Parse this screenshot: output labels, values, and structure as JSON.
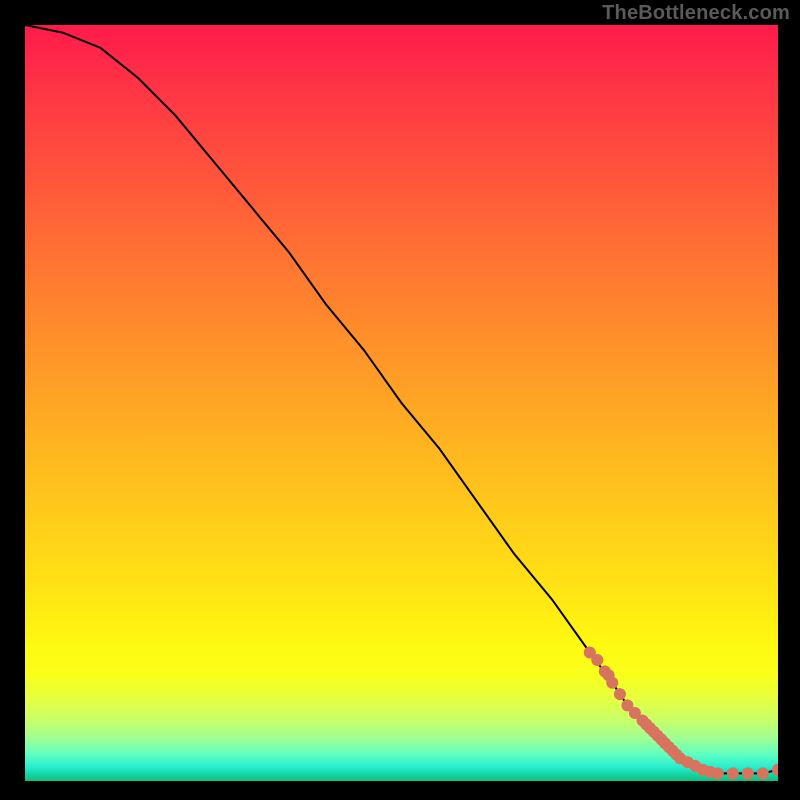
{
  "attribution": "TheBottleneck.com",
  "chart_data": {
    "type": "line",
    "title": "",
    "xlabel": "",
    "ylabel": "",
    "xlim": [
      0,
      100
    ],
    "ylim": [
      0,
      100
    ],
    "series": [
      {
        "name": "curve",
        "x": [
          0,
          5,
          10,
          15,
          20,
          25,
          30,
          35,
          40,
          45,
          50,
          55,
          60,
          65,
          70,
          75,
          78,
          80,
          82,
          84,
          86,
          88,
          90,
          92,
          94,
          96,
          98,
          100
        ],
        "y": [
          100,
          99,
          97,
          93,
          88,
          82,
          76,
          70,
          63,
          57,
          50,
          44,
          37,
          30,
          24,
          17,
          13,
          10,
          8,
          6,
          4,
          2.5,
          1.5,
          1,
          1,
          1,
          1,
          1.5
        ]
      }
    ],
    "scatter_points": {
      "name": "dots",
      "x": [
        75,
        76,
        77,
        77.5,
        78,
        79,
        80,
        81,
        82,
        82.5,
        83,
        83.5,
        84,
        84.5,
        85,
        85.5,
        86,
        86.5,
        87,
        88,
        89,
        90,
        91,
        92,
        94,
        96,
        98,
        100
      ],
      "y": [
        17,
        16,
        14.5,
        14,
        13,
        11.5,
        10,
        9,
        8,
        7.5,
        7,
        6.5,
        6,
        5.5,
        5,
        4.5,
        4,
        3.5,
        3,
        2.5,
        2,
        1.5,
        1.2,
        1,
        1,
        1,
        1,
        1.5
      ]
    },
    "gradient_stops": [
      {
        "pos": 0,
        "color": "#ff1a4b"
      },
      {
        "pos": 50,
        "color": "#ff9b27"
      },
      {
        "pos": 82,
        "color": "#fff911"
      },
      {
        "pos": 100,
        "color": "#0fbf80"
      }
    ]
  }
}
